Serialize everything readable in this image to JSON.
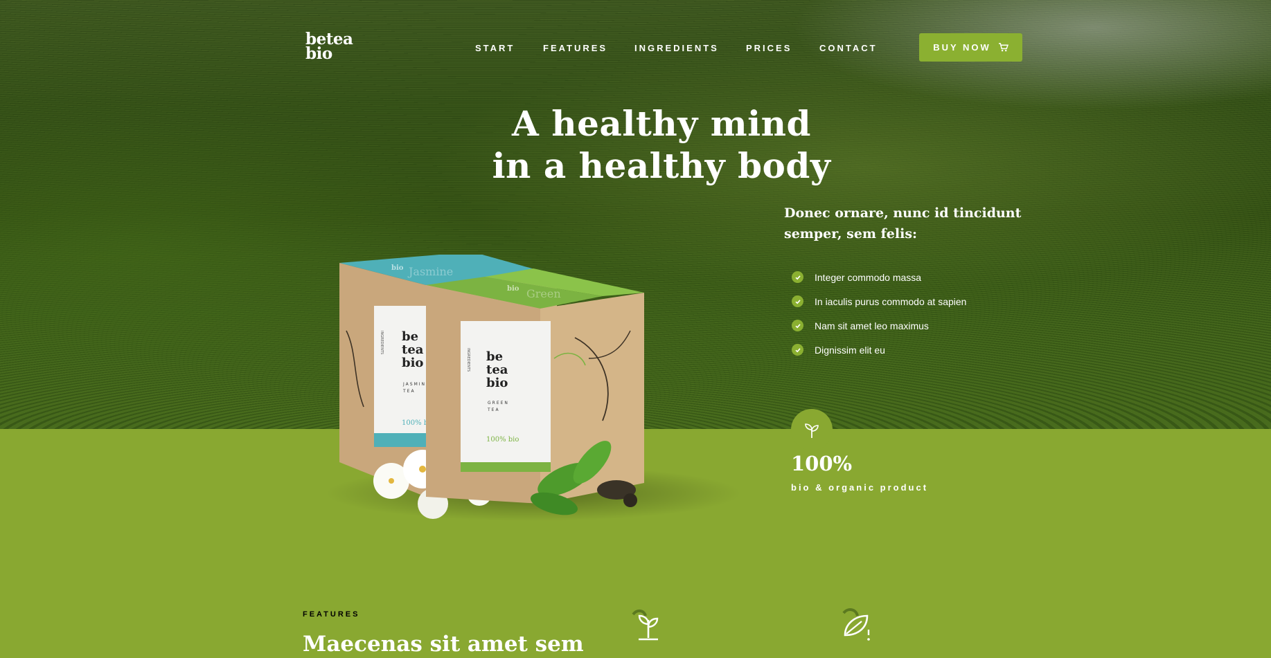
{
  "brand": {
    "line1": "betea",
    "line2": "bio"
  },
  "nav": {
    "items": [
      {
        "label": "START"
      },
      {
        "label": "FEATURES"
      },
      {
        "label": "INGREDIENTS"
      },
      {
        "label": "PRICES"
      },
      {
        "label": "CONTACT"
      }
    ],
    "buy_label": "BUY NOW",
    "buy_icon": "cart-icon"
  },
  "hero": {
    "headline_line1": "A healthy mind",
    "headline_line2": "in a healthy body",
    "intro_line1": "Donec ornare, nunc id tincidunt",
    "intro_line2": "semper, sem felis:",
    "bullets": [
      "Integer commodo massa",
      "In iaculis purus commodo at sapien",
      "Nam sit amet leo maximus",
      "Dignissim elit eu"
    ]
  },
  "product_boxes": {
    "left": {
      "logo1": "be",
      "logo2": "tea",
      "logo3": "bio",
      "flavor1": "JASMINE",
      "flavor2": "TEA",
      "tag": "100% bio",
      "side": "INGREDIENTS",
      "top": "Jasmine",
      "top_logo": "bio"
    },
    "right": {
      "logo1": "be",
      "logo2": "tea",
      "logo3": "bio",
      "flavor1": "GREEN",
      "flavor2": "TEA",
      "tag": "100% bio",
      "side": "INGREDIENTS",
      "top": "Green",
      "top_logo": "bio"
    }
  },
  "badge": {
    "title": "100%",
    "subtitle": "bio & organic product",
    "icon": "sprout-icon"
  },
  "features": {
    "kicker": "FEATURES",
    "title": "Maecenas sit amet sem"
  },
  "colors": {
    "accent": "#8bb031",
    "section_bg": "#89a831",
    "jasmine_teal": "#4fb0b8",
    "box_kraft": "#c9a77c"
  }
}
